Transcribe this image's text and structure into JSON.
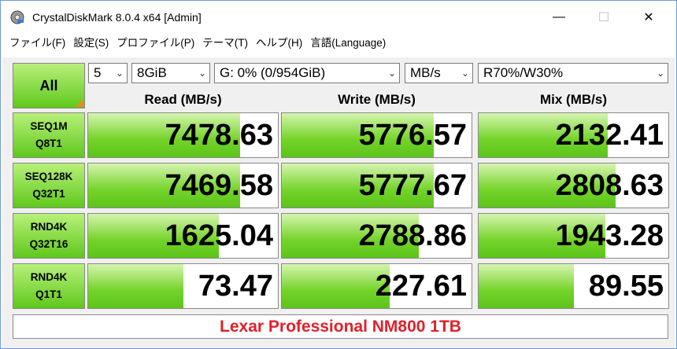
{
  "window": {
    "title": "CrystalDiskMark 8.0.4 x64 [Admin]",
    "minimize_glyph": "—",
    "maximize_glyph": "☐",
    "close_glyph": "✕"
  },
  "menu": [
    "ファイル(F)",
    "設定(S)",
    "プロファイル(P)",
    "テーマ(T)",
    "ヘルプ(H)",
    "言語(Language)"
  ],
  "controls": {
    "all_label": "All",
    "test_count": "5",
    "test_size": "8GiB",
    "drive": "G: 0% (0/954GiB)",
    "unit": "MB/s",
    "mix_ratio": "R70%/W30%"
  },
  "headers": {
    "read": "Read (MB/s)",
    "write": "Write (MB/s)",
    "mix": "Mix (MB/s)"
  },
  "rows": [
    {
      "line1": "SEQ1M",
      "line2": "Q8T1",
      "read": "7478.63",
      "write": "5776.57",
      "mix": "2132.41",
      "read_fill": 0.8,
      "write_fill": 0.8,
      "mix_fill": 0.68
    },
    {
      "line1": "SEQ128K",
      "line2": "Q32T1",
      "read": "7469.58",
      "write": "5777.67",
      "mix": "2808.63",
      "read_fill": 0.8,
      "write_fill": 0.8,
      "mix_fill": 0.72
    },
    {
      "line1": "RND4K",
      "line2": "Q32T16",
      "read": "1625.04",
      "write": "2788.86",
      "mix": "1943.28",
      "read_fill": 0.69,
      "write_fill": 0.72,
      "mix_fill": 0.67
    },
    {
      "line1": "RND4K",
      "line2": "Q1T1",
      "read": "73.47",
      "write": "227.61",
      "mix": "89.55",
      "read_fill": 0.5,
      "write_fill": 0.57,
      "mix_fill": 0.5
    }
  ],
  "footer": "Lexar Professional NM800 1TB",
  "colors": {
    "fill": "#74d32a",
    "footer_text": "#e0202a",
    "corner_accent": "#f08a1e"
  }
}
